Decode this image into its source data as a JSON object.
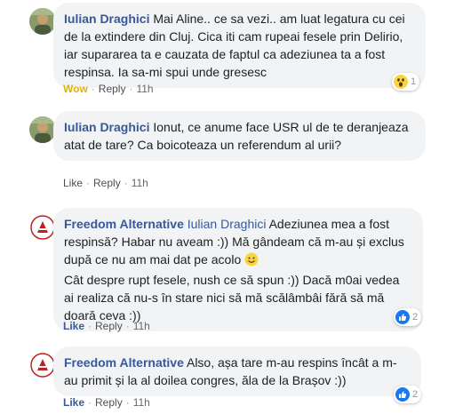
{
  "comments": [
    {
      "author": "Iulian Draghici",
      "tag": "",
      "text": "Mai Aline.. ce sa vezi.. am luat legatura cu cei de la extindere din Cluj. Cica iti cam rupeai fesele prin Delirio, iar supararea ta e cauzata de faptul ca adeziunea ta a fost respinsa. Ia sa-mi spui unde gresesc",
      "reaction_label": "Wow",
      "reply_label": "Reply",
      "time": "11h",
      "reaction_count": "1",
      "reaction_icon": "wow-icon"
    },
    {
      "author": "Iulian Draghici",
      "tag": "",
      "text": "Ionut, ce anume face USR ul de te deranjeaza atat de tare? Ca boicoteaza un referendum al urii?",
      "reaction_label": "Like",
      "reply_label": "Reply",
      "time": "11h"
    },
    {
      "author": "Freedom Alternative",
      "tag": "Iulian Draghici",
      "text": "Adeziunea mea a fost respinsă? Habar nu aveam :)) Mă gândeam că m-au și exclus după ce nu am mai dat pe acolo",
      "text2": "Cât despre rupt fesele, nush ce să spun :)) Dacă m0ai vedea ai realiza că nu-s în stare nici să mă scălâmbâi fără să mă doară ceva :))",
      "reaction_label": "Like",
      "reply_label": "Reply",
      "time": "11h",
      "reaction_count": "2",
      "reaction_icon": "like-icon"
    },
    {
      "author": "Freedom Alternative",
      "tag": "",
      "text": "Also, așa tare m-au respins încât a m-au primit și la al doilea congres, ăla de la Brașov :))",
      "reaction_label": "Like",
      "reply_label": "Reply",
      "time": "11h",
      "reaction_count": "2",
      "reaction_icon": "like-icon"
    }
  ],
  "colors": {
    "author": "#385898",
    "bubble": "#f2f3f5",
    "wow": "#e2b203",
    "like_blue": "#1877f2"
  }
}
